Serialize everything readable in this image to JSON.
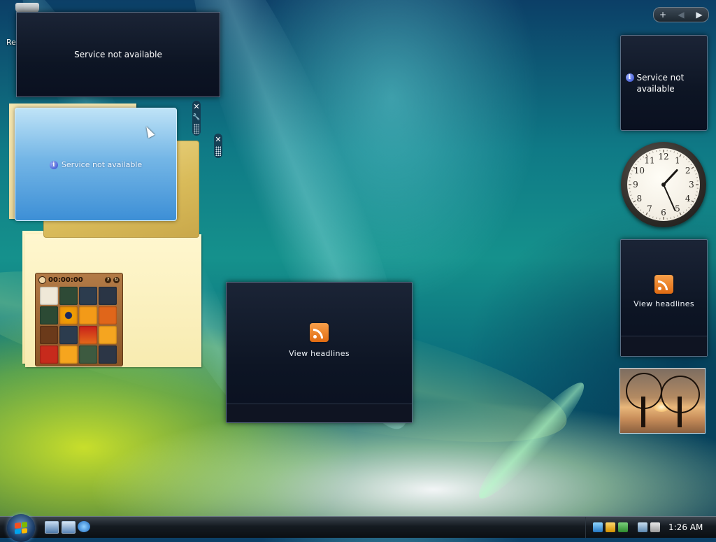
{
  "desktop": {
    "recycle_bin_label": "Re"
  },
  "gadgets": {
    "service_big": {
      "message": "Service not available"
    },
    "service_blue": {
      "message": "Service not available"
    },
    "service_side": {
      "message": "Service not available"
    },
    "rss_big": {
      "label": "View headlines"
    },
    "rss_side": {
      "label": "View headlines"
    },
    "puzzle": {
      "timer": "00:00:00"
    },
    "clock": {
      "numbers": [
        "12",
        "1",
        "2",
        "3",
        "4",
        "5",
        "6",
        "7",
        "8",
        "9",
        "10",
        "11"
      ],
      "hour": 1,
      "minute": 26
    },
    "controls": {
      "close_glyph": "✕",
      "options_glyph": "🔧"
    }
  },
  "sidebar_nav": {
    "add_glyph": "+",
    "prev_glyph": "◀",
    "next_glyph": "▶"
  },
  "taskbar": {
    "time": "1:26 AM"
  },
  "colors": {
    "accent_blue": "#3d8fd6",
    "rss_orange": "#e06b12"
  }
}
